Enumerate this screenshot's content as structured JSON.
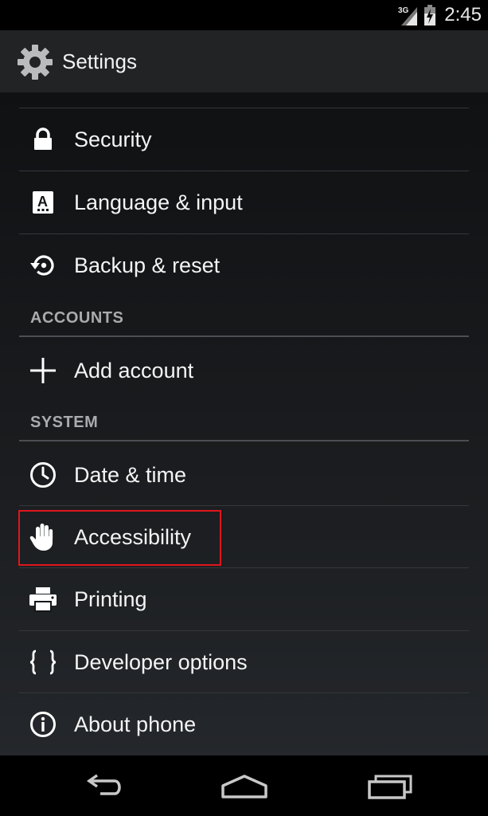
{
  "status_bar": {
    "network": "3G",
    "time": "2:45"
  },
  "action_bar": {
    "title": "Settings",
    "icon": "gear-icon"
  },
  "items": [
    {
      "label": "Security",
      "icon": "lock-icon"
    },
    {
      "label": "Language & input",
      "icon": "keyboard-a-icon"
    },
    {
      "label": "Backup & reset",
      "icon": "backup-restore-icon"
    },
    {
      "label": "Add account",
      "icon": "plus-icon"
    },
    {
      "label": "Date & time",
      "icon": "clock-icon"
    },
    {
      "label": "Accessibility",
      "icon": "hand-icon"
    },
    {
      "label": "Printing",
      "icon": "printer-icon"
    },
    {
      "label": "Developer options",
      "icon": "braces-icon"
    },
    {
      "label": "About phone",
      "icon": "info-icon"
    }
  ],
  "sections": {
    "accounts": "ACCOUNTS",
    "system": "SYSTEM"
  },
  "highlight_color": "#e0161d",
  "nav": [
    "back-icon",
    "home-icon",
    "recent-apps-icon"
  ]
}
